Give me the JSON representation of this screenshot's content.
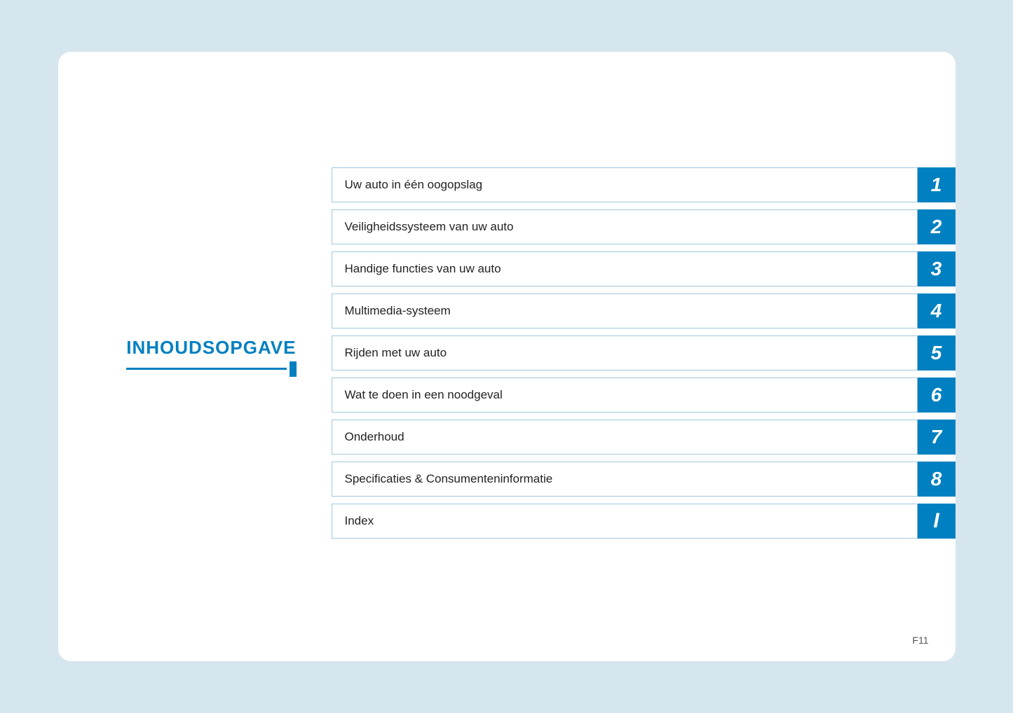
{
  "page": {
    "background_color": "#d6e6ef",
    "footer": "F11"
  },
  "left": {
    "title": "INHOUDSOPGAVE"
  },
  "toc": {
    "items": [
      {
        "label": "Uw auto in één oogopslag",
        "number": "1"
      },
      {
        "label": "Veiligheidssysteem van uw auto",
        "number": "2"
      },
      {
        "label": "Handige functies van uw auto",
        "number": "3"
      },
      {
        "label": "Multimedia-systeem",
        "number": "4"
      },
      {
        "label": "Rijden met uw auto",
        "number": "5"
      },
      {
        "label": "Wat te doen in een noodgeval",
        "number": "6"
      },
      {
        "label": "Onderhoud",
        "number": "7"
      },
      {
        "label": "Specificaties & Consumenteninformatie",
        "number": "8"
      },
      {
        "label": "Index",
        "number": "I"
      }
    ]
  }
}
